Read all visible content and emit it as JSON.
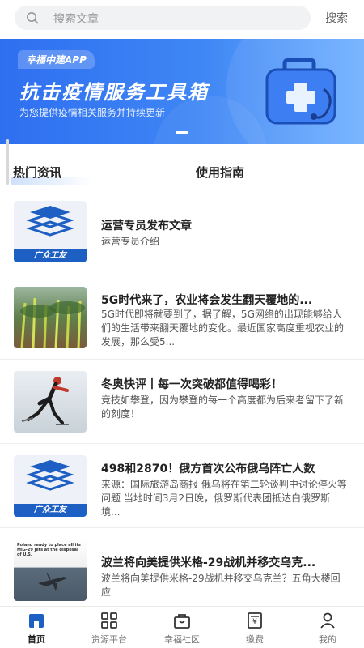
{
  "search": {
    "placeholder": "搜索文章",
    "button_label": "搜索"
  },
  "banner": {
    "tag": "幸福中建APP",
    "title": "抗击疫情服务工具箱",
    "subtitle": "为您提供疫情相关服务并持续更新"
  },
  "tabs": [
    {
      "label": "热门资讯",
      "active": true
    },
    {
      "label": "使用指南",
      "active": false
    }
  ],
  "articles": [
    {
      "title": "运营专员发布文章",
      "desc": "运营专员介绍",
      "thumb": "logo",
      "thumb_text": "广众工友"
    },
    {
      "title": "5G时代来了，农业将会发生翻天覆地的...",
      "desc": "5G时代即将就要到了，据了解，5G网络的出现能够给人们的生活带来翻天覆地的变化。最近国家高度重视农业的发展，那么受5...",
      "thumb": "farm"
    },
    {
      "title": "冬奥快评丨每一次突破都值得喝彩！",
      "desc": "竞技如攀登，因为攀登的每一个高度都为后来者留下了新的刻度！",
      "thumb": "skate"
    },
    {
      "title": "498和2870！俄方首次公布俄乌阵亡人数",
      "desc": "来源：国际旅游岛商报 俄乌将在第二轮谈判中讨论停火等问题 当地时间3月2日晚，俄罗斯代表团抵达白俄罗斯境...",
      "thumb": "logo",
      "thumb_text": "广众工友"
    },
    {
      "title": "波兰将向美提供米格-29战机并移交乌克...",
      "desc": "波兰将向美提供米格-29战机并移交乌克兰？五角大楼回应",
      "thumb": "jet",
      "thumb_text": "Poland ready to place all its MiG-29 jets at the disposal of U.S."
    }
  ],
  "nav": [
    {
      "label": "首页",
      "icon": "home-icon",
      "active": true
    },
    {
      "label": "资源平台",
      "icon": "grid-icon",
      "active": false
    },
    {
      "label": "幸福社区",
      "icon": "bag-icon",
      "active": false
    },
    {
      "label": "缴费",
      "icon": "bill-icon",
      "active": false
    },
    {
      "label": "我的",
      "icon": "person-icon",
      "active": false
    }
  ],
  "colors": {
    "accent": "#2e6ff0",
    "brand_blue": "#1e5fc4"
  }
}
